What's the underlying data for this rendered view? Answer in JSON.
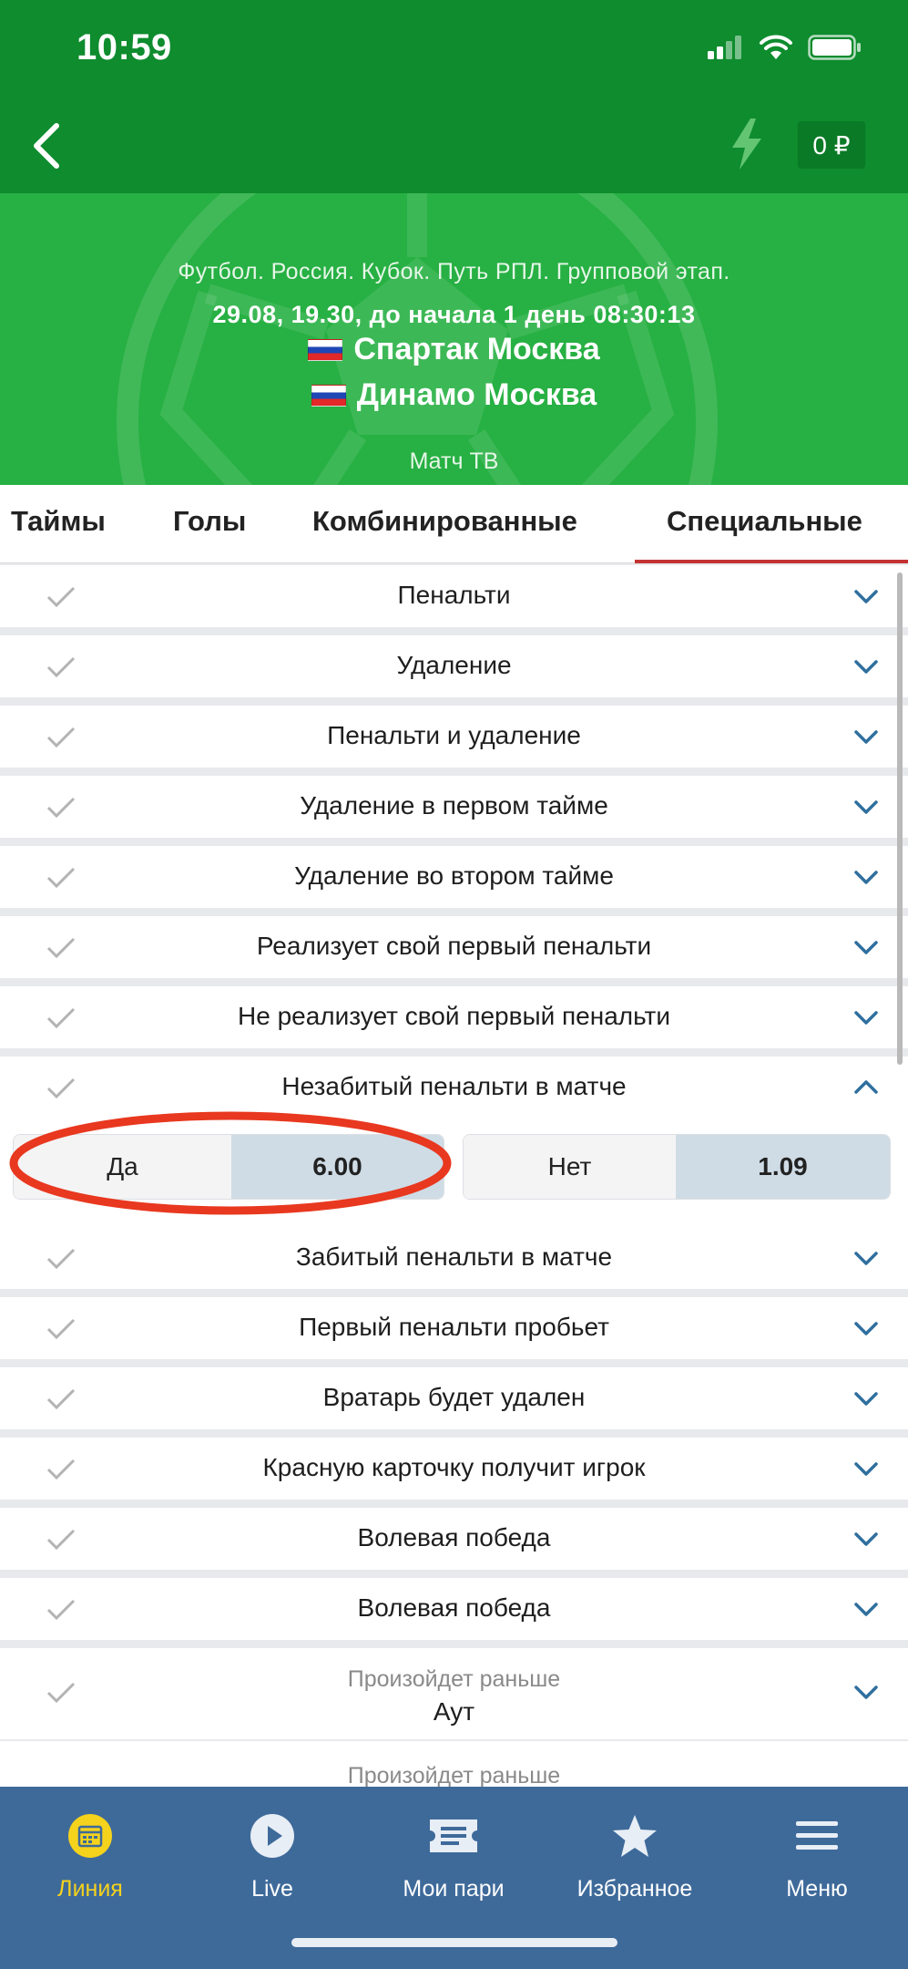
{
  "status_bar": {
    "time": "10:59"
  },
  "header": {
    "balance": "0 ₽"
  },
  "match": {
    "tournament": "Футбол. Россия. Кубок. Путь РПЛ. Групповой этап.",
    "datetime": "29.08, 19.30,  до начала 1 день 08:30:13",
    "team1": "Спартак Москва",
    "team2": "Динамо Москва",
    "broadcast": "Матч ТВ"
  },
  "tabs": [
    {
      "label": "Таймы"
    },
    {
      "label": "Голы"
    },
    {
      "label": "Комбинированные"
    },
    {
      "label": "Специальные",
      "active": true
    }
  ],
  "markets": [
    {
      "label": "Пенальти",
      "expanded": false
    },
    {
      "label": "Удаление",
      "expanded": false
    },
    {
      "label": "Пенальти и удаление",
      "expanded": false
    },
    {
      "label": "Удаление в первом тайме",
      "expanded": false
    },
    {
      "label": "Удаление во втором тайме",
      "expanded": false
    },
    {
      "label": "Реализует свой первый пенальти",
      "expanded": false
    },
    {
      "label": "Не реализует свой первый пенальти",
      "expanded": false
    },
    {
      "label": "Незабитый пенальти в матче",
      "expanded": true
    },
    {
      "label": "Забитый пенальти в матче",
      "expanded": false
    },
    {
      "label": "Первый пенальти пробьет",
      "expanded": false
    },
    {
      "label": "Вратарь будет удален",
      "expanded": false
    },
    {
      "label": "Красную карточку получит игрок",
      "expanded": false
    },
    {
      "label": "Волевая победа",
      "expanded": false
    },
    {
      "label": "Волевая победа",
      "expanded": false
    },
    {
      "sublabel": "Произойдет раньше",
      "label": "Аут",
      "expanded": false
    },
    {
      "sublabel": "Произойдет раньше"
    }
  ],
  "expanded_odds": [
    {
      "label": "Да",
      "value": "6.00",
      "highlighted": true
    },
    {
      "label": "Нет",
      "value": "1.09"
    }
  ],
  "bottom_nav": [
    {
      "label": "Линия",
      "icon": "calendar-icon",
      "active": true
    },
    {
      "label": "Live",
      "icon": "play-icon"
    },
    {
      "label": "Мои пари",
      "icon": "ticket-icon"
    },
    {
      "label": "Избранное",
      "icon": "star-icon"
    },
    {
      "label": "Меню",
      "icon": "menu-icon"
    }
  ],
  "colors": {
    "header_green": "#0e8c2e",
    "hero_green": "#27b043",
    "tab_accent": "#c43333",
    "odds_value_bg": "#cfdce6",
    "annotation_red": "#e8381f",
    "nav_blue": "#3e6a9a",
    "nav_active": "#f5d21c"
  }
}
